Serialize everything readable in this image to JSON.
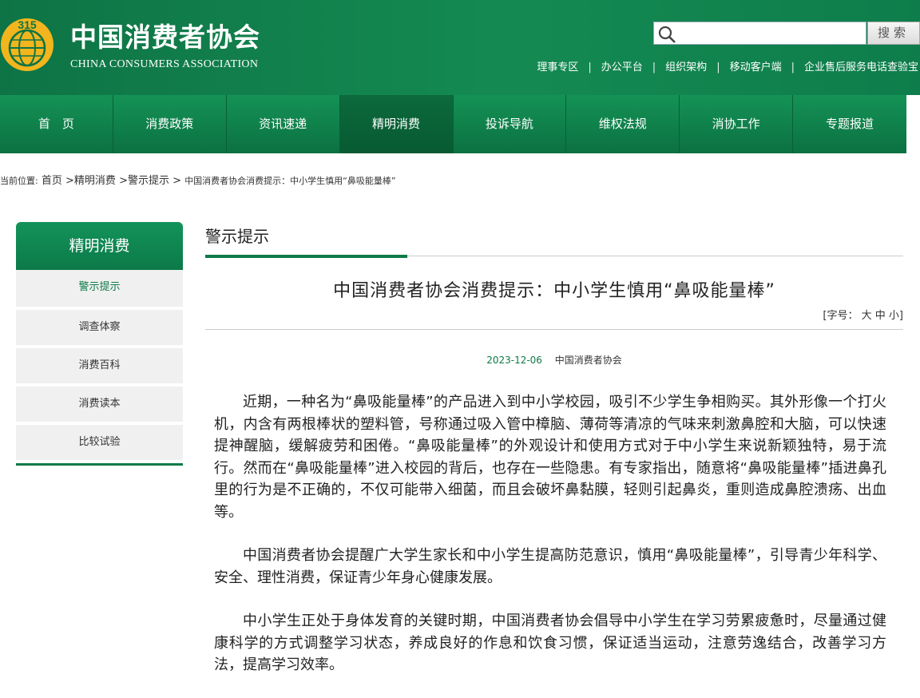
{
  "header": {
    "logo_cn": "中国消费者协会",
    "logo_en": "CHINA CONSUMERS ASSOCIATION",
    "search": {
      "placeholder": "",
      "button_label": "搜索"
    },
    "links": [
      "理事专区",
      "办公平台",
      "组织架构",
      "移动客户端",
      "企业售后服务电话查验宝"
    ]
  },
  "nav": {
    "items": [
      "首　页",
      "消费政策",
      "资讯速递",
      "精明消费",
      "投诉导航",
      "维权法规",
      "消协工作",
      "专题报道"
    ],
    "active_index": 3
  },
  "breadcrumb": {
    "prefix": "当前位置:",
    "items": [
      "首页",
      "精明消费",
      "警示提示",
      "中国消费者协会消费提示：中小学生慎用“鼻吸能量棒”"
    ]
  },
  "sidebar": {
    "title": "精明消费",
    "items": [
      "警示提示",
      "调查体察",
      "消费百科",
      "消费读本",
      "比较试验"
    ],
    "active_index": 0
  },
  "main": {
    "section_title": "警示提示",
    "article_title": "中国消费者协会消费提示：中小学生慎用“鼻吸能量棒”",
    "font_size_label": "[字号：",
    "font_sizes": [
      "大",
      "中",
      "小"
    ],
    "font_size_close": "]",
    "date": "2023-12-06",
    "source": "中国消费者协会",
    "paragraphs": [
      "近期，一种名为“鼻吸能量棒”的产品进入到中小学校园，吸引不少学生争相购买。其外形像一个打火机，内含有两根棒状的塑料管，号称通过吸入管中樟脑、薄荷等清凉的气味来刺激鼻腔和大脑，可以快速提神醒脑，缓解疲劳和困倦。“鼻吸能量棒”的外观设计和使用方式对于中小学生来说新颖独特，易于流行。然而在“鼻吸能量棒”进入校园的背后，也存在一些隐患。有专家指出，随意将“鼻吸能量棒”插进鼻孔里的行为是不正确的，不仅可能带入细菌，而且会破坏鼻黏膜，轻则引起鼻炎，重则造成鼻腔溃疡、出血等。",
      "中国消费者协会提醒广大学生家长和中小学生提高防范意识，慎用“鼻吸能量棒”，引导青少年科学、安全、理性消费，保证青少年身心健康发展。",
      "中小学生正处于身体发育的关键时期，中国消费者协会倡导中小学生在学习劳累疲惫时，尽量通过健康科学的方式调整学习状态，养成良好的作息和饮食习惯，保证适当运动，注意劳逸结合，改善学习方法，提高学习效率。"
    ]
  },
  "colors": {
    "brand_green": "#0c7a48",
    "nav_green": "#0f7d49",
    "logo_gold": "#f2b51e"
  }
}
